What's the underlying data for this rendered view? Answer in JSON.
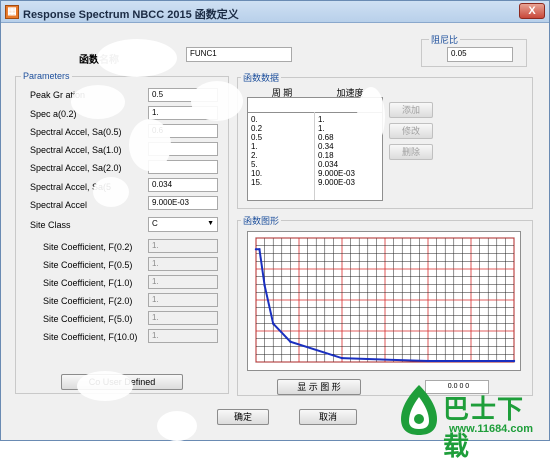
{
  "window": {
    "title": "Response Spectrum NBCC 2015 函数定义",
    "close_glyph": "X"
  },
  "function_name": {
    "label": "函数名称",
    "value": "FUNC1"
  },
  "damping": {
    "group_label": "阻尼比",
    "value": "0.05"
  },
  "parameters": {
    "group_label": "Parameters",
    "rows": [
      {
        "label": "Peak Gr        ation",
        "value": "0.5"
      },
      {
        "label": "Spec         a(0.2)",
        "value": "1."
      },
      {
        "label": "Spectral Accel, Sa(0.5)",
        "value": "0.6"
      },
      {
        "label": "Spectral Accel, Sa(1.0)",
        "value": ""
      },
      {
        "label": "Spectral Accel, Sa(2.0)",
        "value": ""
      },
      {
        "label": "Spectral Accel, Sa(5",
        "value": "0.034"
      },
      {
        "label": "Spectral Accel",
        "value": "9.000E-03"
      }
    ],
    "site_class": {
      "label": "Site Class",
      "value": "C",
      "arrow": "▼"
    },
    "coefficients": [
      {
        "label": "Site Coefficient, F(0.2)",
        "value": "1."
      },
      {
        "label": "Site Coefficient, F(0.5)",
        "value": "1."
      },
      {
        "label": "Site Coefficient, F(1.0)",
        "value": "1."
      },
      {
        "label": "Site Coefficient, F(2.0)",
        "value": "1."
      },
      {
        "label": "Site Coefficient, F(5.0)",
        "value": "1."
      },
      {
        "label": "Site Coefficient, F(10.0)",
        "value": "1."
      }
    ],
    "user_defined_button": "Co       User Defined"
  },
  "function_data": {
    "group_label": "函数数据",
    "col_period": "周 期",
    "col_accel": "加速度",
    "periods": [
      "0.",
      "0.2",
      "0.5",
      "1.",
      "2.",
      "5.",
      "10.",
      "15."
    ],
    "accels": [
      "1.",
      "1.",
      "0.68",
      "0.34",
      "0.18",
      "0.034",
      "9.000E-03",
      "9.000E-03"
    ],
    "add_button": "添加",
    "modify_button": "修改",
    "delete_button": "删除"
  },
  "function_graph": {
    "group_label": "函数图形",
    "show_button": "显 示 图 形",
    "readout": "0.0 0 0"
  },
  "footer": {
    "ok_button": "确定",
    "cancel_button": "取消"
  },
  "watermark": {
    "text_big": "巴士下载",
    "text_small": "www.11684.com",
    "brand_color": "#1e9e3a"
  },
  "chart_data": {
    "type": "line",
    "x": [
      0,
      0.2,
      0.5,
      1,
      2,
      5,
      10,
      15
    ],
    "y": [
      1,
      1,
      0.68,
      0.34,
      0.18,
      0.034,
      0.009,
      0.009
    ],
    "xlim": [
      0,
      15
    ],
    "ylim": [
      0,
      1.1
    ],
    "grid": true,
    "line_color": "#1a2fbf",
    "grid_color": "#d62828"
  }
}
